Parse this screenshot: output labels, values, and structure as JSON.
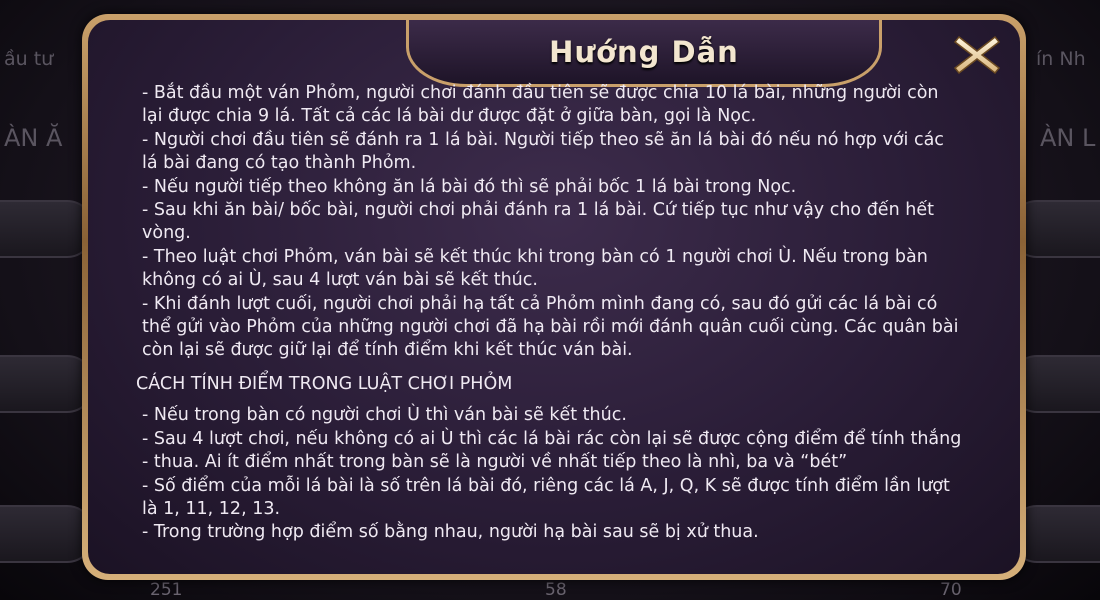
{
  "background": {
    "left_label": "ầu tư",
    "right_label": "ín Nh",
    "left_label2": "ÀN Ă",
    "right_label2": "ÀN L",
    "num_left": "251",
    "num_mid": "58",
    "num_right": "70"
  },
  "modal": {
    "title": "Hướng Dẫn",
    "close_icon": "close-x-icon",
    "paragraphs": [
      "- Bắt đầu một ván Phỏm, người chơi đánh đầu tiên sẽ được chia 10 lá bài, những người còn lại được chia 9 lá. Tất cả các lá bài dư được đặt ở giữa bàn, gọi là Nọc.",
      "- Người chơi đầu tiên sẽ đánh ra 1 lá bài. Người tiếp theo sẽ ăn lá bài đó nếu nó hợp với các lá bài đang có tạo thành Phỏm.",
      "- Nếu người tiếp theo không ăn lá bài đó thì sẽ phải bốc 1 lá bài trong Nọc.",
      "- Sau khi ăn bài/ bốc bài, người chơi phải đánh ra 1 lá bài. Cứ tiếp tục như vậy cho đến hết vòng.",
      "- Theo luật chơi Phỏm, ván bài sẽ kết thúc khi trong bàn có 1 người chơi Ù. Nếu trong bàn không có ai Ù, sau 4 lượt ván bài sẽ kết thúc.",
      "- Khi đánh lượt cuối, người chơi phải hạ tất cả Phỏm mình đang có, sau đó gửi các lá bài có thể gửi vào Phỏm của những người chơi đã hạ bài rồi mới đánh quân cuối cùng. Các quân bài còn lại sẽ được giữ lại để tính điểm khi kết thúc ván bài."
    ],
    "section_heading": "CÁCH TÍNH ĐIỂM TRONG LUẬT CHƠI PHỎM",
    "scoring_paragraphs": [
      "- Nếu trong bàn có người chơi Ù thì ván bài sẽ kết thúc.",
      "- Sau 4 lượt chơi, nếu không có ai Ù thì các lá bài rác còn lại sẽ được cộng điểm để tính thắng - thua. Ai ít điểm nhất trong bàn sẽ là người về nhất tiếp theo là nhì, ba và “bét”",
      "- Số điểm của mỗi lá bài là số trên lá bài đó, riêng các lá A, J, Q, K sẽ được tính điểm lần lượt là 1, 11, 12, 13.",
      "- Trong trường hợp điểm số bằng nhau, người hạ bài sau sẽ bị xử thua."
    ]
  }
}
